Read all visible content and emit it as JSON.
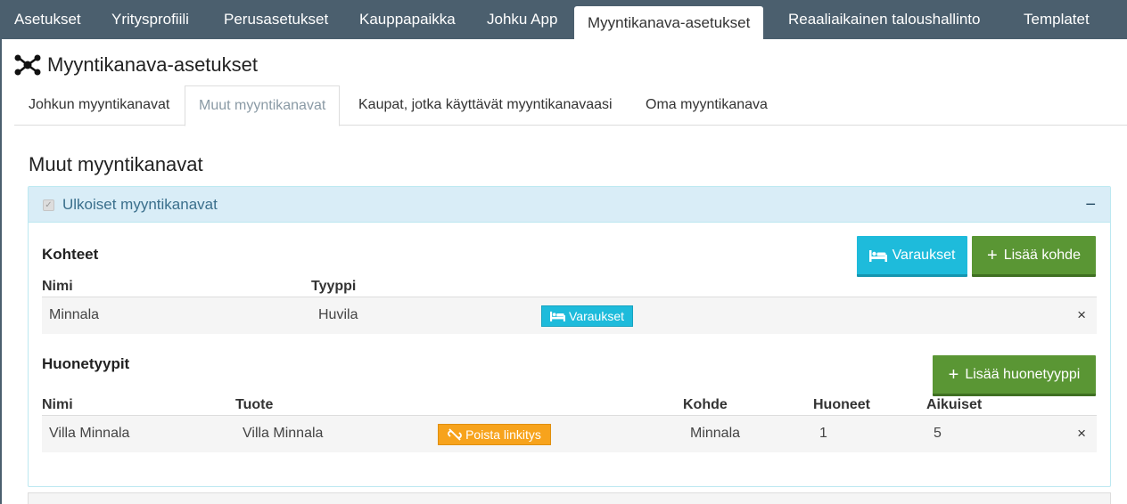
{
  "nav": {
    "items": [
      {
        "label": "Asetukset",
        "active": false
      },
      {
        "label": "Yritysprofiili",
        "active": false
      },
      {
        "label": "Perusasetukset",
        "active": false
      },
      {
        "label": "Kauppapaikka",
        "active": false
      },
      {
        "label": "Johku App",
        "active": false
      },
      {
        "label": "Myyntikanava-asetukset",
        "active": true
      },
      {
        "label": "Reaaliaikainen taloushallinto",
        "active": false
      },
      {
        "label": "Templatet",
        "active": false
      }
    ]
  },
  "page": {
    "title": "Myyntikanava-asetukset",
    "title_icon": "share-network-icon"
  },
  "subtabs": [
    {
      "label": "Johkun myyntikanavat",
      "active": false
    },
    {
      "label": "Muut myyntikanavat",
      "active": true
    },
    {
      "label": "Kaupat, jotka käyttävät myyntikanavaasi",
      "active": false
    },
    {
      "label": "Oma myyntikanava",
      "active": false
    }
  ],
  "section": {
    "heading": "Muut myyntikanavat"
  },
  "panel": {
    "title": "Ulkoiset myyntikanavat",
    "checked": true,
    "collapse_symbol": "−",
    "kohteet": {
      "heading": "Kohteet",
      "reservations_button": "Varaukset",
      "add_button": "Lisää kohde",
      "columns": [
        "Nimi",
        "Tyyppi"
      ],
      "rows": [
        {
          "nimi": "Minnala",
          "tyyppi": "Huvila",
          "button": "Varaukset",
          "remove": "×"
        }
      ]
    },
    "huonetyypit": {
      "heading": "Huonetyypit",
      "add_button": "Lisää huonetyyppi",
      "columns": [
        "Nimi",
        "Tuote",
        "Kohde",
        "Huoneet",
        "Aikuiset"
      ],
      "rows": [
        {
          "nimi": "Villa Minnala",
          "tuote": "Villa Minnala",
          "button": "Poista linkitys",
          "kohde": "Minnala",
          "huoneet": "1",
          "aikuiset": "5",
          "remove": "×"
        }
      ]
    }
  },
  "colors": {
    "nav_bg": "#4b5f6e",
    "info": "#1ebbdb",
    "success": "#5a9634",
    "warning": "#f7a31c",
    "panel_header_bg": "#d9edf7"
  }
}
